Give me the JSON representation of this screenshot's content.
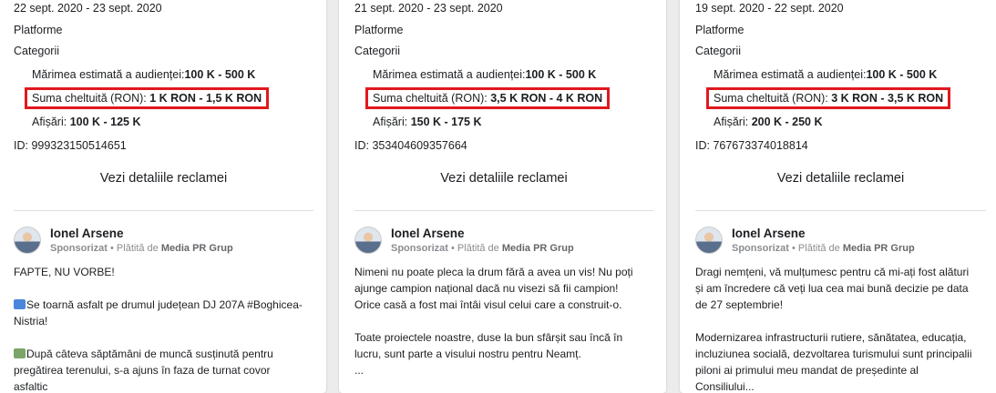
{
  "cards": [
    {
      "dates": "22 sept. 2020 - 23 sept. 2020",
      "platforms_label": "Platforme",
      "categories_label": "Categorii",
      "audience_label": "Mărimea estimată a audienței:",
      "audience_value": "100 K - 500 K",
      "spend_label": "Suma cheltuită (RON): ",
      "spend_value": "1 K RON - 1,5 K RON",
      "impressions_label": "Afișări: ",
      "impressions_value": "100 K - 125 K",
      "ad_id": "ID: 999323150514651",
      "details_button": "Vezi detaliile reclamei",
      "advertiser": "Ionel Arsene",
      "sponsored": "Sponsorizat",
      "paid_by_prefix": " • Plătită de ",
      "paid_by": "Media PR Grup",
      "text": {
        "p1": "FAPTE, NU VORBE!",
        "p2": "Se toarnă asfalt pe drumul județean DJ 207A #Boghicea-Nistria!",
        "p3": "După câteva săptămâni de muncă susținută pentru pregătirea terenului, s-a ajuns în faza de turnat covor asfaltic"
      },
      "icons": [
        "new-emoji-icon",
        "road-emoji-icon"
      ]
    },
    {
      "dates": "21 sept. 2020 - 23 sept. 2020",
      "platforms_label": "Platforme",
      "categories_label": "Categorii",
      "audience_label": "Mărimea estimată a audienței:",
      "audience_value": "100 K - 500 K",
      "spend_label": "Suma cheltuită (RON): ",
      "spend_value": "3,5 K RON - 4 K RON",
      "impressions_label": "Afișări: ",
      "impressions_value": "150 K - 175 K",
      "ad_id": "ID: 353404609357664",
      "details_button": "Vezi detaliile reclamei",
      "advertiser": "Ionel Arsene",
      "sponsored": "Sponsorizat",
      "paid_by_prefix": " • Plătită de ",
      "paid_by": "Media PR Grup",
      "text": {
        "p1": "Nimeni nu poate pleca la drum fără a avea un vis! Nu poți ajunge campion național dacă nu visezi să fii campion! Orice casă a fost mai întâi visul celui care a construit-o.",
        "p2": "Toate proiectele noastre, duse la bun sfârșit sau încă în lucru, sunt parte a visului nostru pentru Neamț.",
        "p3": "..."
      }
    },
    {
      "dates": "19 sept. 2020 - 22 sept. 2020",
      "platforms_label": "Platforme",
      "categories_label": "Categorii",
      "audience_label": "Mărimea estimată a audienței:",
      "audience_value": "100 K - 500 K",
      "spend_label": "Suma cheltuită (RON): ",
      "spend_value": "3 K RON - 3,5 K RON",
      "impressions_label": "Afișări: ",
      "impressions_value": "200 K - 250 K",
      "ad_id": "ID: 767673374018814",
      "details_button": "Vezi detaliile reclamei",
      "advertiser": "Ionel Arsene",
      "sponsored": "Sponsorizat",
      "paid_by_prefix": " • Plătită de ",
      "paid_by": "Media PR Grup",
      "text": {
        "p1": "Dragi nemțeni, vă mulțumesc pentru că mi-ați fost alături și am încredere că veți lua cea mai bună decizie pe data de 27 septembrie!",
        "p2": "Modernizarea infrastructurii rutiere, sănătatea, educația, incluziunea socială, dezvoltarea turismului sunt principalii piloni ai primului meu mandat de președinte al Consiliului..."
      }
    }
  ],
  "highlight_color": "#e0191e"
}
